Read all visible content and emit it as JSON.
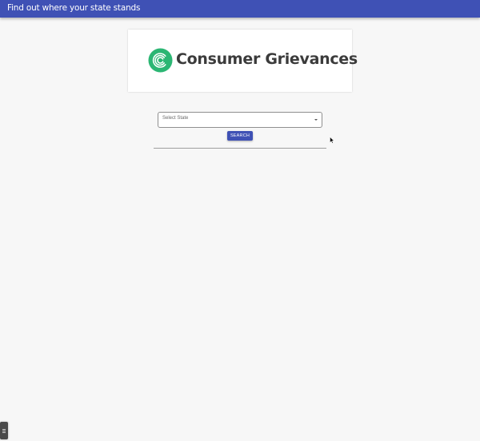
{
  "appbar": {
    "title": "Find out where your state stands"
  },
  "logo": {
    "text": "Consumer Grievances",
    "icon": "concentric-c-logo-icon",
    "color": "#2bb673"
  },
  "form": {
    "state_select": {
      "placeholder": "Select State",
      "icon": "dropdown-arrow-icon"
    },
    "search_label": "SEARCH"
  },
  "colors": {
    "primary": "#3f51b5",
    "background": "#f7f7f7",
    "logo_green": "#2bb673"
  }
}
